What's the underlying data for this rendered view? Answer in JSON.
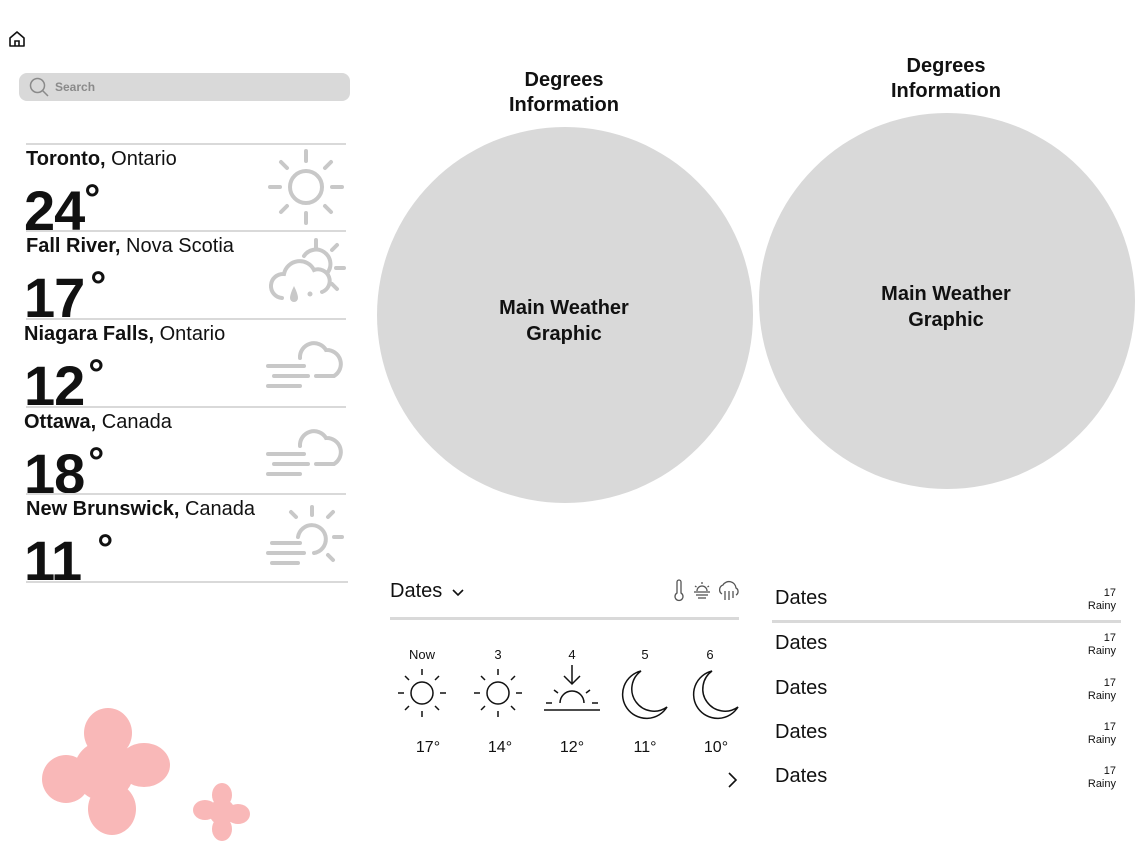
{
  "nav": {
    "home_icon": "home-icon"
  },
  "search": {
    "placeholder": "Search",
    "icon": "search-icon"
  },
  "cities": [
    {
      "city": "Toronto,",
      "region": " Ontario",
      "temp": "24",
      "icon": "sun-icon"
    },
    {
      "city": "Fall River,",
      "region": " Nova Scotia",
      "temp": "17",
      "icon": "partly-cloudy-rain-icon"
    },
    {
      "city": "Niagara Falls,",
      "region": " Ontario",
      "temp": "12",
      "icon": "cloud-fog-icon"
    },
    {
      "city": "Ottawa,",
      "region": " Canada",
      "temp": "18",
      "icon": "cloud-fog-icon"
    },
    {
      "city": "New Brunswick,",
      "region": " Canada",
      "temp": "11",
      "icon": "sun-haze-icon"
    }
  ],
  "degree_symbol": "°",
  "main_panels": [
    {
      "title_line1": "Degrees",
      "title_line2": "Information",
      "graphic_line1": "Main Weather",
      "graphic_line2": "Graphic"
    },
    {
      "title_line1": "Degrees",
      "title_line2": "Information",
      "graphic_line1": "Main Weather",
      "graphic_line2": "Graphic"
    }
  ],
  "hourly": {
    "dropdown_label": "Dates",
    "view_icons": [
      "thermometer-icon",
      "sunset-icon",
      "rain-cloud-icon"
    ],
    "items": [
      {
        "label": "Now",
        "temp": "17°",
        "icon": "sun-icon"
      },
      {
        "label": "3",
        "temp": "14°",
        "icon": "sun-icon"
      },
      {
        "label": "4",
        "temp": "12°",
        "icon": "sunset-icon"
      },
      {
        "label": "5",
        "temp": "11°",
        "icon": "moon-icon"
      },
      {
        "label": "6",
        "temp": "10°",
        "icon": "moon-icon"
      }
    ],
    "next_icon": "chevron-right-icon"
  },
  "daily": [
    {
      "name": "Dates",
      "temp": "17",
      "condition": "Rainy"
    },
    {
      "name": "Dates",
      "temp": "17",
      "condition": "Rainy"
    },
    {
      "name": "Dates",
      "temp": "17",
      "condition": "Rainy"
    },
    {
      "name": "Dates",
      "temp": "17",
      "condition": "Rainy"
    },
    {
      "name": "Dates",
      "temp": "17",
      "condition": "Rainy"
    }
  ],
  "colors": {
    "placeholder_gray": "#d9d9d9",
    "icon_gray": "#c8c8c8",
    "decor_pink": "#f9b8b8"
  }
}
